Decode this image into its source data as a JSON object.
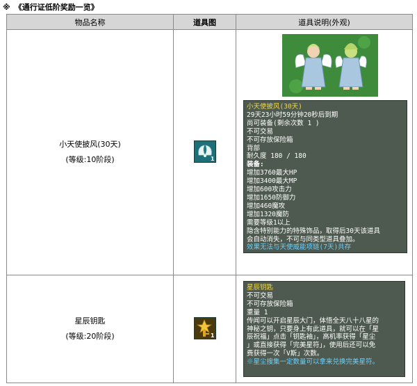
{
  "title": {
    "mark": "※",
    "text": "《通行证低阶奖励一览》"
  },
  "headers": [
    "物品名称",
    "道具图",
    "道具说明(外观)"
  ],
  "items": [
    {
      "name": "小天使披风(30天)",
      "level": "(等级:10阶段)",
      "icon": "angel-wing-cape-icon",
      "icon_qty": "1",
      "tooltip": [
        "小天使披风(30天)",
        "29天23小时59分钟20秒后到期",
        "尚可装备(剩余次数 1 )",
        "不可交易",
        "不可存放保险箱",
        "背部",
        "耐久度 180 / 180",
        "装备:",
        "增加3760最大HP",
        "增加3400最大MP",
        "增加600攻击力",
        "增加1650防御力",
        "增加460魔攻",
        "增加1320魔防",
        "需要等级1以上",
        "隐含特别能力的特殊饰品，取得后30天该道具",
        "会自动消失，不可与同类型道具叠加。",
        "效果无法与天使威能项链(7天)共存"
      ]
    },
    {
      "name": "星辰钥匙",
      "level": "(等级:20阶段)",
      "icon": "star-key-icon",
      "icon_qty": "1",
      "tooltip": [
        "星辰钥匙",
        "不可交易",
        "不可存放保险箱",
        "重量 1",
        "传闻可以开启星辰大门，体悟全天八十八星的",
        "神秘之钥，只要身上有此道具，就可以在「星",
        "辰祝福」点击「钥匙袖」，高机率获得「星尘",
        "」或直接获得「完美星符」，使用后还可以免",
        "费获得一次「V斯」次数。",
        "※星尘搜集一定数量可以拿来兑换完美星符。"
      ]
    }
  ],
  "colors": {
    "tooltip_title": "#f0d84a",
    "tooltip_highlight": "#6ad2ff",
    "header_bg": "#d6d6d6"
  }
}
